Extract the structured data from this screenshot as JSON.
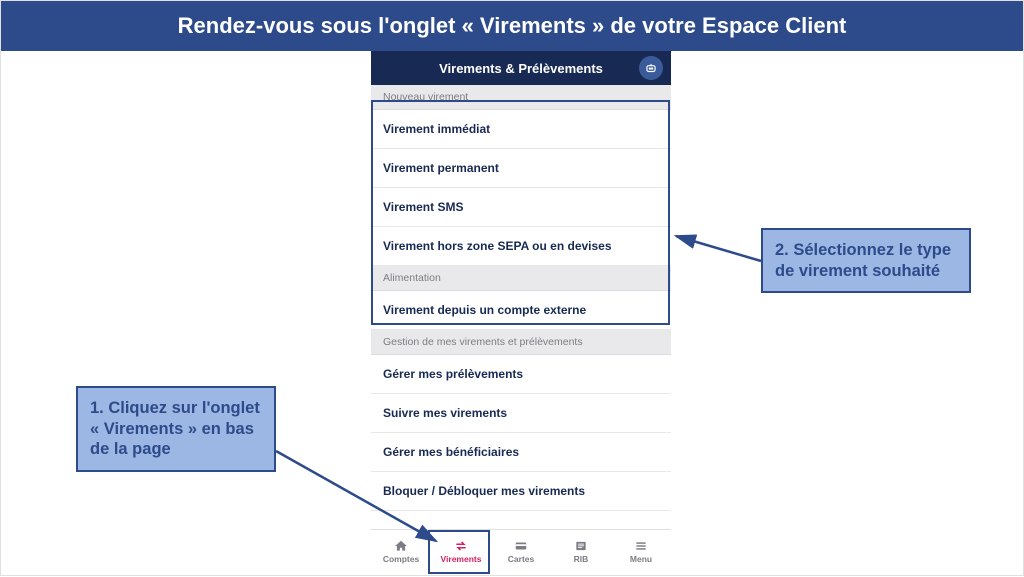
{
  "banner": "Rendez-vous sous l'onglet « Virements » de votre Espace Client",
  "phone": {
    "title": "Virements & Prélèvements",
    "sections": {
      "nouveau": "Nouveau virement",
      "alimentation": "Alimentation",
      "gestion": "Gestion de mes virements et prélèvements"
    },
    "items": {
      "immediat": "Virement immédiat",
      "permanent": "Virement permanent",
      "sms": "Virement SMS",
      "horssepa": "Virement hors zone SEPA ou en devises",
      "externe": "Virement depuis un compte externe",
      "gererprel": "Gérer mes prélèvements",
      "suivre": "Suivre mes virements",
      "benef": "Gérer mes bénéficiaires",
      "bloquer": "Bloquer / Débloquer mes virements"
    },
    "tabs": {
      "comptes": "Comptes",
      "virements": "Virements",
      "cartes": "Cartes",
      "rib": "RIB",
      "menu": "Menu"
    }
  },
  "callouts": {
    "c1": "1. Cliquez sur l'onglet « Virements » en bas de la page",
    "c2": "2. Sélectionnez le type de virement souhaité"
  }
}
